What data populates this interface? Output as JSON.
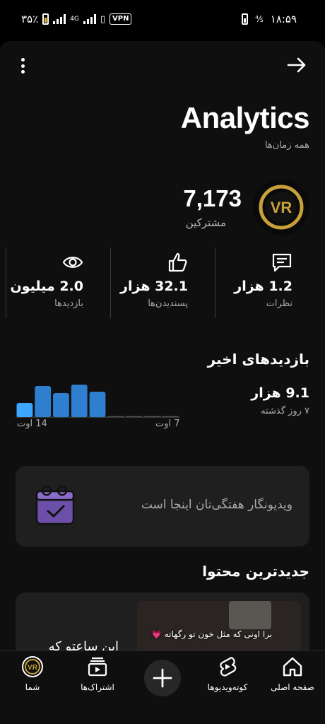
{
  "status_bar": {
    "battery_percent": "۳۵٪",
    "network_label": "4G",
    "vpn_label": "VPN",
    "time": "۱۸:۵۹"
  },
  "header": {
    "title": "Analytics",
    "period": "همه زمان‌ها"
  },
  "channel": {
    "subscribers": "7,173",
    "subscribers_label": "مشترکین",
    "avatar_initials": "VR"
  },
  "stats": [
    {
      "value": "2.0 میلیون",
      "label": "بازدیدها",
      "icon": "eye-icon"
    },
    {
      "value": "32.1 هزار",
      "label": "پسندیدن‌ها",
      "icon": "thumbs-up-icon"
    },
    {
      "value": "1.2 هزار",
      "label": "نظرات",
      "icon": "comment-icon"
    }
  ],
  "recent": {
    "title": "بازدیدهای اخیر",
    "value": "9.1 هزار",
    "subtitle": "۷ روز گذشته",
    "chart_start_label": "14 اوت",
    "chart_end_label": "7 اوت"
  },
  "chart_data": {
    "type": "bar",
    "categories": [
      "",
      "",
      "",
      "",
      "",
      "",
      "",
      "",
      ""
    ],
    "values": [
      1.0,
      2.2,
      1.7,
      2.3,
      1.8,
      0.05,
      0.05,
      0.05,
      0.05
    ],
    "highlight_index": 0,
    "colors": {
      "bar": "#2f7fd1",
      "highlight": "#3ea6ff",
      "baseline": "#555555"
    }
  },
  "promo": {
    "text": "ویدیونگار هفتگی‌تان اینجا است",
    "icon": "calendar-check-icon"
  },
  "latest": {
    "title": "جدیدترین محتوا",
    "video_title": "این ساعتو که",
    "thumbnail_caption": "برا اونی که مثل خون تو رگهاته 💗"
  },
  "bottom_nav": [
    {
      "label": "صفحه اصلی",
      "icon": "home-icon"
    },
    {
      "label": "کوته‌ویدیوها",
      "icon": "shorts-icon"
    },
    {
      "label": "",
      "icon": "create-plus-icon"
    },
    {
      "label": "اشتراک‌ها",
      "icon": "subscriptions-icon"
    },
    {
      "label": "شما",
      "icon": "channel-avatar-icon"
    }
  ],
  "colors": {
    "accent": "#3ea6ff",
    "logo_gold": "#c8a03a",
    "promo_icon": "#6b4fa8"
  }
}
